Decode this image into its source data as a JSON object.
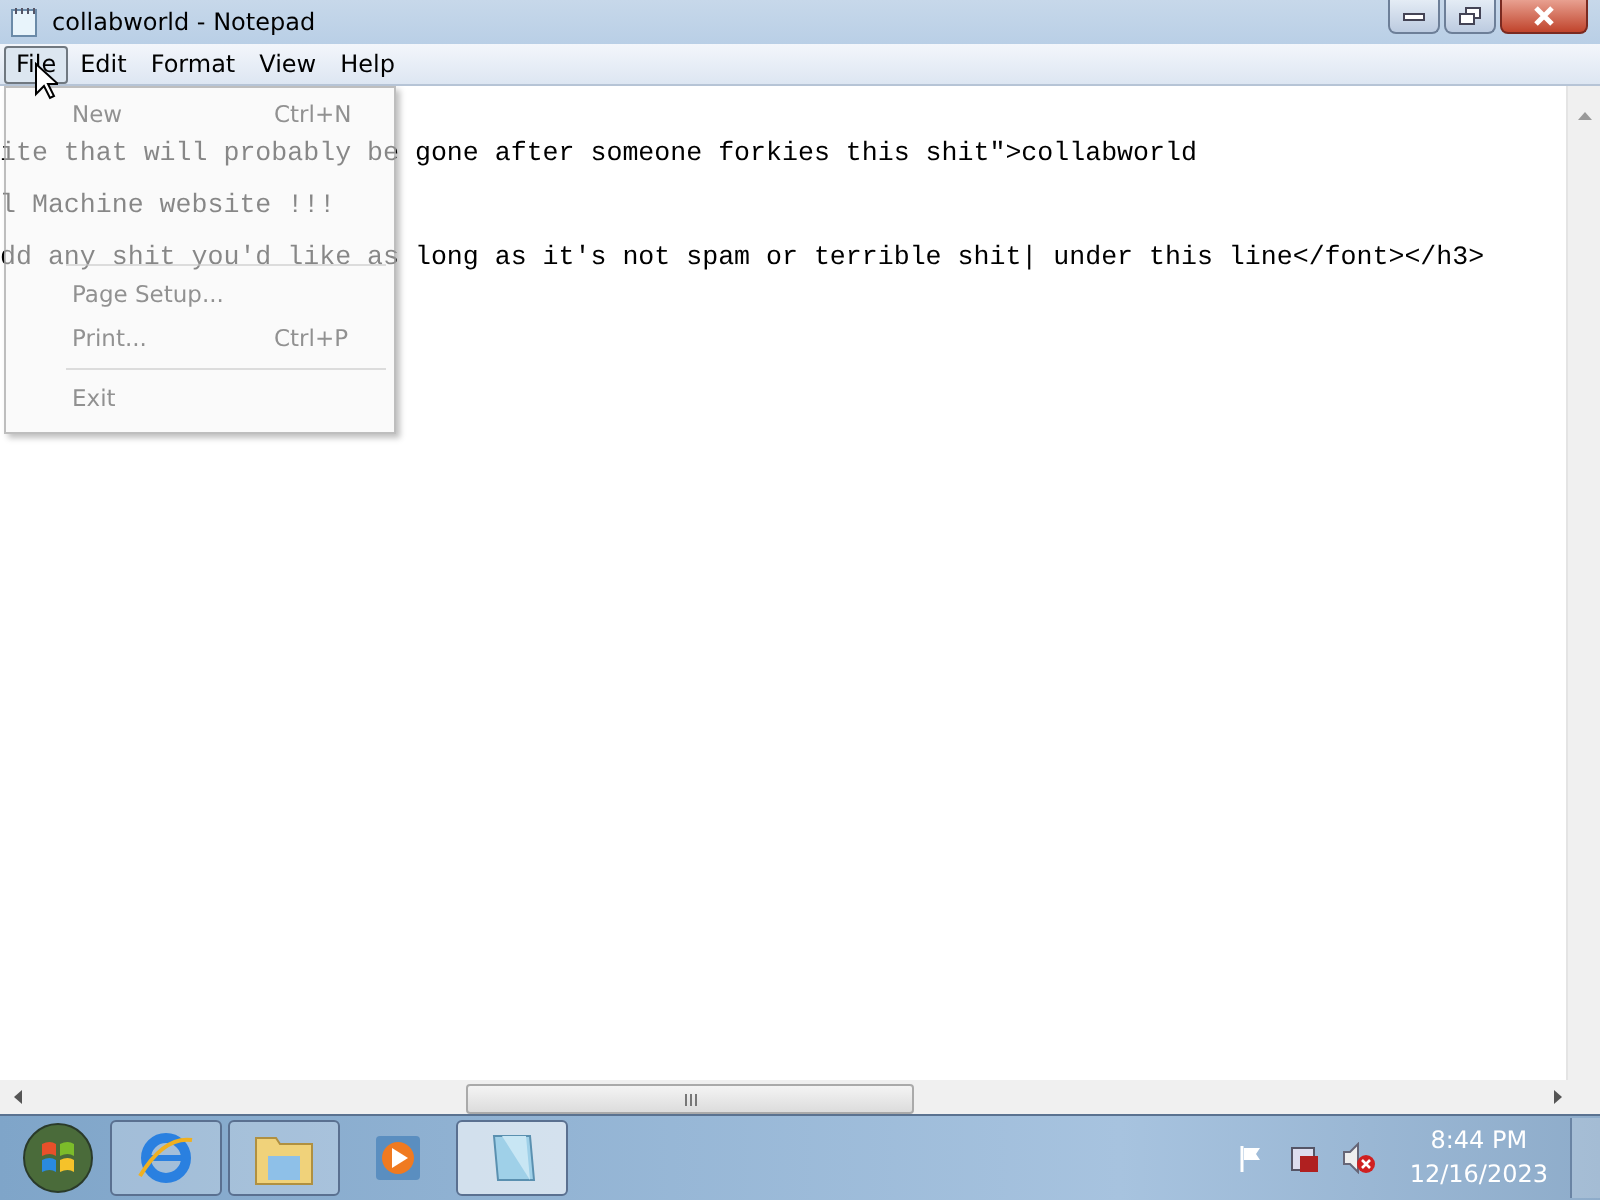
{
  "window": {
    "title": "collabworld - Notepad"
  },
  "menubar": [
    {
      "label": "File",
      "selected": true
    },
    {
      "label": "Edit",
      "selected": false
    },
    {
      "label": "Format",
      "selected": false
    },
    {
      "label": "View",
      "selected": false
    },
    {
      "label": "Help",
      "selected": false
    }
  ],
  "file_menu": [
    {
      "label": "New",
      "shortcut": "Ctrl+N",
      "separator_before": false
    },
    {
      "label": "Page Setup...",
      "separator_before": true
    },
    {
      "label": "Print...",
      "shortcut": "Ctrl+P",
      "separator_before": false
    },
    {
      "label": "Exit",
      "separator_before": true
    }
  ],
  "document_lines": [
    "ite that will probably be gone after someone forkies this shit\">collabworld",
    "l Machine website !!!",
    "dd any shit you'd like as long as it's not spam or terrible shit| under this line</font></h3>"
  ],
  "taskbar": {
    "apps": [
      {
        "kind": "browser",
        "selected": false
      },
      {
        "kind": "folder",
        "selected": false
      },
      {
        "kind": "media",
        "selected": false
      },
      {
        "kind": "notepad",
        "selected": true
      }
    ],
    "time": "8:44 PM",
    "date": "12/16/2023"
  }
}
